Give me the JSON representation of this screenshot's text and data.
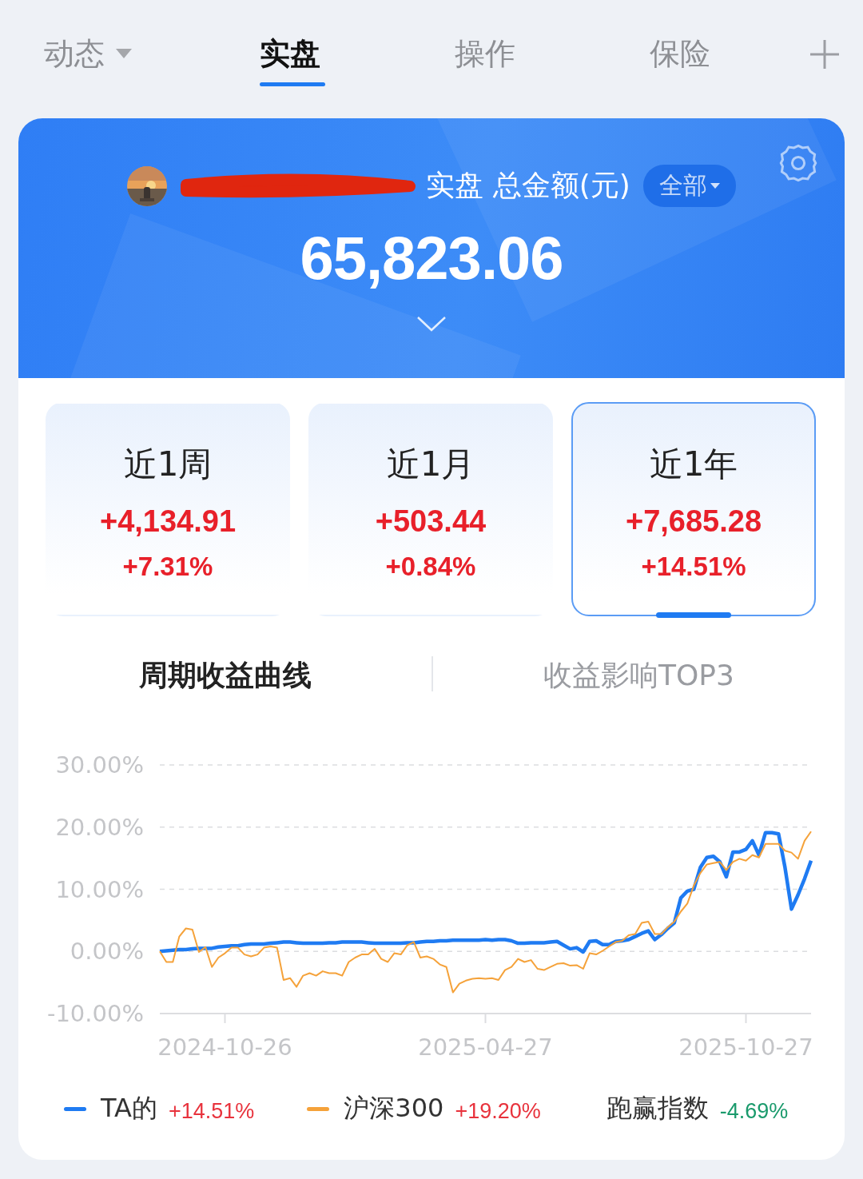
{
  "top_tabs": [
    {
      "label": "动态",
      "selected": false,
      "dropdown": true
    },
    {
      "label": "实盘",
      "selected": true,
      "dropdown": false
    },
    {
      "label": "操作",
      "selected": false,
      "dropdown": false
    },
    {
      "label": "保险",
      "selected": false,
      "dropdown": false
    }
  ],
  "summary": {
    "title": "实盘 总金额(元)",
    "filter": "全部",
    "total": "65,823.06"
  },
  "periods": [
    {
      "label": "近1周",
      "amount": "+4,134.91",
      "percent": "+7.31%",
      "selected": false
    },
    {
      "label": "近1月",
      "amount": "+503.44",
      "percent": "+0.84%",
      "selected": false
    },
    {
      "label": "近1年",
      "amount": "+7,685.28",
      "percent": "+14.51%",
      "selected": true
    }
  ],
  "chart_tabs": [
    {
      "label": "周期收益曲线",
      "selected": true
    },
    {
      "label": "收益影响TOP3",
      "selected": false
    }
  ],
  "chart_data": {
    "type": "line",
    "grid": true,
    "categories": [
      null,
      null,
      null,
      null,
      null,
      null,
      null,
      null,
      null,
      null,
      "2024-10-26",
      null,
      null,
      null,
      null,
      null,
      null,
      null,
      null,
      null,
      null,
      null,
      null,
      null,
      null,
      null,
      null,
      null,
      null,
      null,
      null,
      null,
      null,
      null,
      null,
      null,
      null,
      null,
      null,
      null,
      null,
      null,
      null,
      null,
      null,
      null,
      null,
      null,
      null,
      null,
      "2025-04-27",
      null,
      null,
      null,
      null,
      null,
      null,
      null,
      null,
      null,
      null,
      null,
      null,
      null,
      null,
      null,
      null,
      null,
      null,
      null,
      null,
      null,
      null,
      null,
      null,
      null,
      null,
      null,
      null,
      null,
      null,
      null,
      null,
      null,
      null,
      null,
      null,
      null,
      null,
      null,
      "2025-10-27",
      null,
      null,
      null,
      null,
      null,
      null,
      null,
      null,
      null,
      null
    ],
    "ylim": [
      -10,
      30
    ],
    "yticks": [
      {
        "value": -10,
        "label": "-10.00%"
      },
      {
        "value": 0,
        "label": "0.00%"
      },
      {
        "value": 10,
        "label": "10.00%"
      },
      {
        "value": 20,
        "label": "20.00%"
      },
      {
        "value": 30,
        "label": "30.00%"
      }
    ],
    "series": [
      {
        "name": "TA的",
        "color": "#1f7bf2",
        "values": [
          0,
          0.1,
          0.2,
          0.3,
          0.3,
          0.4,
          0.5,
          0.5,
          0.5,
          0.7,
          0.8,
          0.9,
          0.9,
          1.1,
          1.2,
          1.2,
          1.2,
          1.3,
          1.4,
          1.5,
          1.5,
          1.4,
          1.3,
          1.3,
          1.3,
          1.3,
          1.4,
          1.4,
          1.5,
          1.5,
          1.5,
          1.5,
          1.4,
          1.3,
          1.3,
          1.3,
          1.3,
          1.3,
          1.4,
          1.4,
          1.5,
          1.6,
          1.6,
          1.7,
          1.7,
          1.8,
          1.8,
          1.8,
          1.8,
          1.8,
          1.9,
          1.8,
          1.9,
          1.9,
          1.7,
          1.3,
          1.3,
          1.4,
          1.4,
          1.4,
          1.5,
          1.6,
          1.0,
          0.4,
          0.6,
          -0.1,
          1.6,
          1.7,
          1.1,
          1.1,
          1.6,
          1.7,
          1.9,
          2.4,
          2.9,
          3.3,
          1.9,
          2.7,
          3.7,
          4.6,
          8.6,
          9.7,
          10.0,
          13.5,
          15.1,
          15.3,
          14.4,
          12.0,
          16.0,
          16.0,
          16.4,
          17.8,
          15.5,
          19.1,
          19.1,
          18.9,
          13.5,
          6.8,
          9.1,
          11.7,
          14.6
        ]
      },
      {
        "name": "沪深300",
        "color": "#f5a23a",
        "values": [
          0,
          -1.7,
          -1.7,
          2.4,
          3.7,
          3.5,
          -0.1,
          0.7,
          -2.5,
          -1.0,
          -0.3,
          0.6,
          0.6,
          -0.5,
          -0.8,
          -0.5,
          0.6,
          0.8,
          0.6,
          -4.6,
          -4.3,
          -5.7,
          -3.9,
          -3.5,
          -3.9,
          -3.2,
          -3.5,
          -3.5,
          -3.9,
          -1.7,
          -1.0,
          -0.5,
          -0.5,
          0.4,
          -1.2,
          -1.7,
          -0.3,
          -0.5,
          1.0,
          1.5,
          -1.0,
          -0.8,
          -1.2,
          -2.1,
          -2.5,
          -6.6,
          -5.2,
          -4.7,
          -4.4,
          -4.3,
          -4.4,
          -4.3,
          -4.6,
          -3.0,
          -2.5,
          -1.2,
          -1.7,
          -1.4,
          -2.8,
          -3.0,
          -2.5,
          -2.0,
          -1.9,
          -2.3,
          -2.2,
          -2.8,
          -0.3,
          -0.5,
          0.1,
          0.8,
          1.5,
          1.7,
          2.6,
          2.8,
          4.6,
          4.8,
          2.8,
          2.8,
          3.9,
          4.8,
          6.4,
          7.7,
          10.6,
          12.6,
          14.0,
          14.2,
          14.4,
          13.1,
          14.4,
          14.9,
          14.6,
          15.5,
          15.1,
          17.3,
          17.3,
          17.3,
          16.2,
          15.9,
          14.9,
          17.8,
          19.3
        ]
      }
    ]
  },
  "legend": [
    {
      "kind": "series",
      "value": "+14.51%",
      "color": "#e8323c"
    },
    {
      "kind": "series",
      "value": "+19.20%",
      "color": "#e8323c"
    },
    {
      "kind": "plain",
      "label": "跑赢指数",
      "value": "-4.69%",
      "color": "#1a9a6c"
    }
  ]
}
